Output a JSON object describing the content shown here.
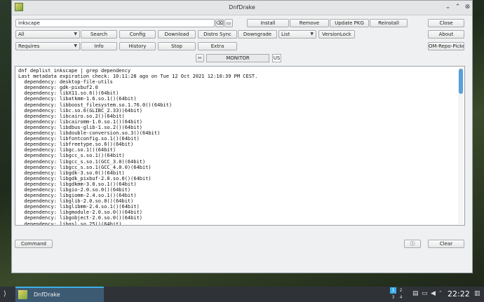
{
  "window": {
    "title": "DnfDrake",
    "minimize_glyph": "⌄",
    "maximize_glyph": "⌃",
    "close_glyph": "⊗"
  },
  "toolbar": {
    "search_input_value": "inkscape",
    "install": "Install",
    "remove": "Remove",
    "update_pkg": "Update PKG",
    "reinstall": "Reinstall",
    "close": "Close",
    "filter_all": "All",
    "search": "Search",
    "config": "Config",
    "download": "Download",
    "distro_sync": "Distro Sync",
    "downgrade": "Downgrade",
    "list_mode": "List",
    "versionlock": "VersionLock",
    "about": "About",
    "requires": "Requires",
    "info": "Info",
    "history": "History",
    "stop": "Stop",
    "extra": "Extra",
    "om_repo_picker": "OM-Repo-Picker"
  },
  "monitor": {
    "label": "MONITOR",
    "lang": "US"
  },
  "output": {
    "lines": [
      "dnf deplist inkscape | grep dependency",
      "Last metadata expiration check: 10:11:28 ago on Tue 12 Oct 2021 12:10:39 PM CEST.",
      "  dependency: desktop-file-utils",
      "  dependency: gdk-pixbuf2.0",
      "  dependency: libX11.so.6()(64bit)",
      "  dependency: libatkmm-1.6.so.1()(64bit)",
      "  dependency: libboost_filesystem.so.1.76.0()(64bit)",
      "  dependency: libc.so.6(GLIBC_2.33)(64bit)",
      "  dependency: libcairo.so.2()(64bit)",
      "  dependency: libcairomm-1.0.so.1()(64bit)",
      "  dependency: libdbus-glib-1.so.2()(64bit)",
      "  dependency: libdouble-conversion.so.3()(64bit)",
      "  dependency: libfontconfig.so.1()(64bit)",
      "  dependency: libfreetype.so.6()(64bit)",
      "  dependency: libgc.so.1()(64bit)",
      "  dependency: libgcc_s.so.1()(64bit)",
      "  dependency: libgcc_s.so.1(GCC_3.0)(64bit)",
      "  dependency: libgcc_s.so.1(GCC_4.0.0)(64bit)",
      "  dependency: libgdk-3.so.0()(64bit)",
      "  dependency: libgdk_pixbuf-2.0.so.0()(64bit)",
      "  dependency: libgdkmm-3.0.so.1()(64bit)",
      "  dependency: libgio-2.0.so.0()(64bit)",
      "  dependency: libgiomm-2.4.so.1()(64bit)",
      "  dependency: libglib-2.0.so.0()(64bit)",
      "  dependency: libglibmm-2.4.so.1()(64bit)",
      "  dependency: libgmodule-2.0.so.0()(64bit)",
      "  dependency: libgobject-2.0.so.0()(64bit)",
      "  dependency: libgsl.so.25()(64bit)"
    ]
  },
  "bottom": {
    "command": "Command",
    "clear": "Clear"
  },
  "taskbar": {
    "app_label": "DnfDrake",
    "clock": "22:22",
    "pager": [
      "1",
      "2",
      "3",
      "4"
    ]
  }
}
